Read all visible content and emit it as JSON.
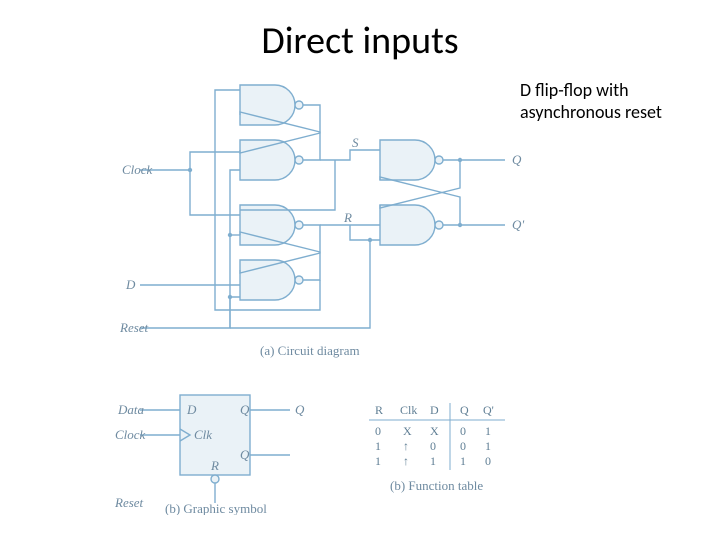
{
  "title": "Direct inputs",
  "caption_line1": "D flip-flop with",
  "caption_line2": "asynchronous reset",
  "pins": {
    "clock": "Clock",
    "d": "D",
    "reset": "Reset",
    "s": "S",
    "r": "R",
    "q": "Q",
    "qbar": "Q'",
    "data": "Data",
    "clk": "Clk"
  },
  "figure_labels": {
    "a": "(a) Circuit diagram",
    "b": "(b) Function table",
    "symbol": "(b) Graphic symbol",
    "symbol_d": "D",
    "symbol_clk": "Clk",
    "symbol_r": "R"
  },
  "truth_table": {
    "headers": [
      "R",
      "Clk",
      "D",
      "Q",
      "Q'"
    ],
    "rows": [
      [
        "0",
        "X",
        "X",
        "0",
        "1"
      ],
      [
        "1",
        "↑",
        "0",
        "0",
        "1"
      ],
      [
        "1",
        "↑",
        "1",
        "1",
        "0"
      ]
    ]
  }
}
